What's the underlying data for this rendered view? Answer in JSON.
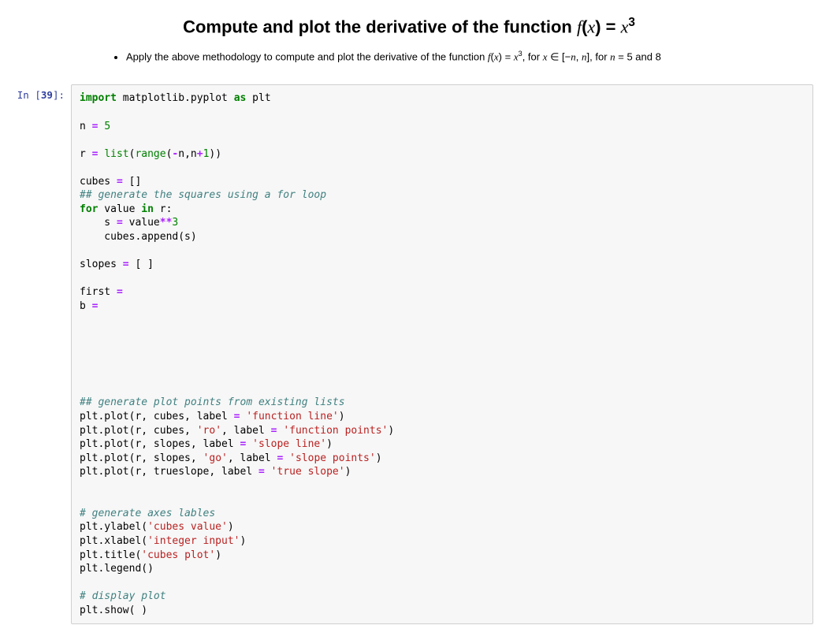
{
  "heading": {
    "prefix": "Compute and plot the derivative of the function ",
    "fx": "f",
    "lparen": "(",
    "x": "x",
    "rparen": ")",
    "eq": " = ",
    "xvar": "x",
    "exp": "3"
  },
  "bullet": {
    "prefix": "Apply the above methodology to compute and plot the derivative of the function ",
    "fx": "f",
    "lparen": "(",
    "x": "x",
    "rparen": ")",
    "eq": " = ",
    "xvar": "x",
    "exp": "3",
    "mid": ", for ",
    "xvar2": "x",
    "in": " ∈ ",
    "lbr": "[−",
    "n1": "n",
    "comma": ", ",
    "n2": "n",
    "rbr": "]",
    "for": ", for ",
    "n3": "n",
    "eq2": " = ",
    "fiveAnd8": "5 and 8"
  },
  "prompt": {
    "in": "In [",
    "num": "39",
    "close": "]:"
  },
  "code": {
    "l01a": "import",
    "l01b": " matplotlib.pyplot ",
    "l01c": "as",
    "l01d": " plt",
    "l03a": "n ",
    "l03b": "=",
    "l03c": " ",
    "l03d": "5",
    "l05a": "r ",
    "l05b": "=",
    "l05c": " ",
    "l05d": "list",
    "l05e": "(",
    "l05f": "range",
    "l05g": "(",
    "l05h": "-",
    "l05i": "n,n",
    "l05j": "+",
    "l05k": "1",
    "l05l": "))",
    "l07a": "cubes ",
    "l07b": "=",
    "l07c": " []",
    "l08": "## generate the squares using a for loop",
    "l09a": "for",
    "l09b": " value ",
    "l09c": "in",
    "l09d": " r:",
    "l10a": "    s ",
    "l10b": "=",
    "l10c": " value",
    "l10d": "**",
    "l10e": "3",
    "l11": "    cubes.append(s)",
    "l13a": "slopes ",
    "l13b": "=",
    "l13c": " [ ] ",
    "l15a": "first ",
    "l15b": "=",
    "l16a": "b ",
    "l16b": "=",
    "l16c": " ",
    "l24": "## generate plot points from existing lists",
    "l25a": "plt.plot(r, cubes, label ",
    "l25b": "=",
    "l25c": " ",
    "l25d": "'function line'",
    "l25e": ")",
    "l26a": "plt.plot(r, cubes, ",
    "l26b": "'ro'",
    "l26c": ", label ",
    "l26d": "=",
    "l26e": " ",
    "l26f": "'function points'",
    "l26g": ")",
    "l27a": "plt.plot(r, slopes, label ",
    "l27b": "=",
    "l27c": " ",
    "l27d": "'slope line'",
    "l27e": ")",
    "l28a": "plt.plot(r, slopes, ",
    "l28b": "'go'",
    "l28c": ", label ",
    "l28d": "=",
    "l28e": " ",
    "l28f": "'slope points'",
    "l28g": ")",
    "l29a": "plt.plot(r, trueslope, label ",
    "l29b": "=",
    "l29c": " ",
    "l29d": "'true slope'",
    "l29e": ")",
    "l32": "# generate axes lables",
    "l33a": "plt.ylabel(",
    "l33b": "'cubes value'",
    "l33c": ")",
    "l34a": "plt.xlabel(",
    "l34b": "'integer input'",
    "l34c": ")",
    "l35a": "plt.title(",
    "l35b": "'cubes plot'",
    "l35c": ")",
    "l36": "plt.legend()",
    "l38": "# display plot",
    "l39": "plt.show( )"
  }
}
